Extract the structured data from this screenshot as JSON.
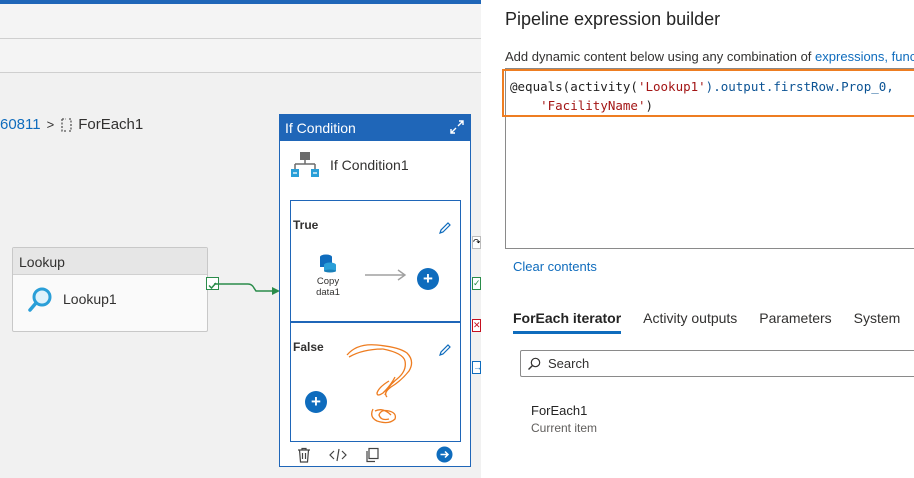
{
  "breadcrumb": {
    "parent": "60811",
    "separator": ">",
    "current": "ForEach1"
  },
  "lookup_activity": {
    "header": "Lookup",
    "name": "Lookup1"
  },
  "if_condition": {
    "header": "If Condition",
    "name": "If Condition1",
    "true_label": "True",
    "false_label": "False",
    "copy_activity": {
      "line1": "Copy",
      "line2": "data1"
    }
  },
  "panel": {
    "title": "Pipeline expression builder",
    "description": "Add dynamic content below using any combination of",
    "description_link": "expressions, func",
    "expression": {
      "line1_prefix": "@equals(activity(",
      "line1_string": "'Lookup1'",
      "line1_suffix": ").output.firstRow.Prop_0,",
      "line2_indent": "    ",
      "line2_string": "'FacilityName'",
      "line2_suffix": ")"
    },
    "clear_contents": "Clear contents",
    "tabs": [
      {
        "label": "ForEach iterator",
        "active": true
      },
      {
        "label": "Activity outputs",
        "active": false
      },
      {
        "label": "Parameters",
        "active": false
      },
      {
        "label": "System",
        "active": false
      }
    ],
    "search_placeholder": "Search",
    "iterator_item": {
      "name": "ForEach1",
      "description": "Current item"
    }
  },
  "colors": {
    "accent": "#1f66b8",
    "link": "#0f6cbd",
    "highlight": "#ee7d21",
    "success": "#2a8c4a",
    "error": "#c50f1f"
  }
}
